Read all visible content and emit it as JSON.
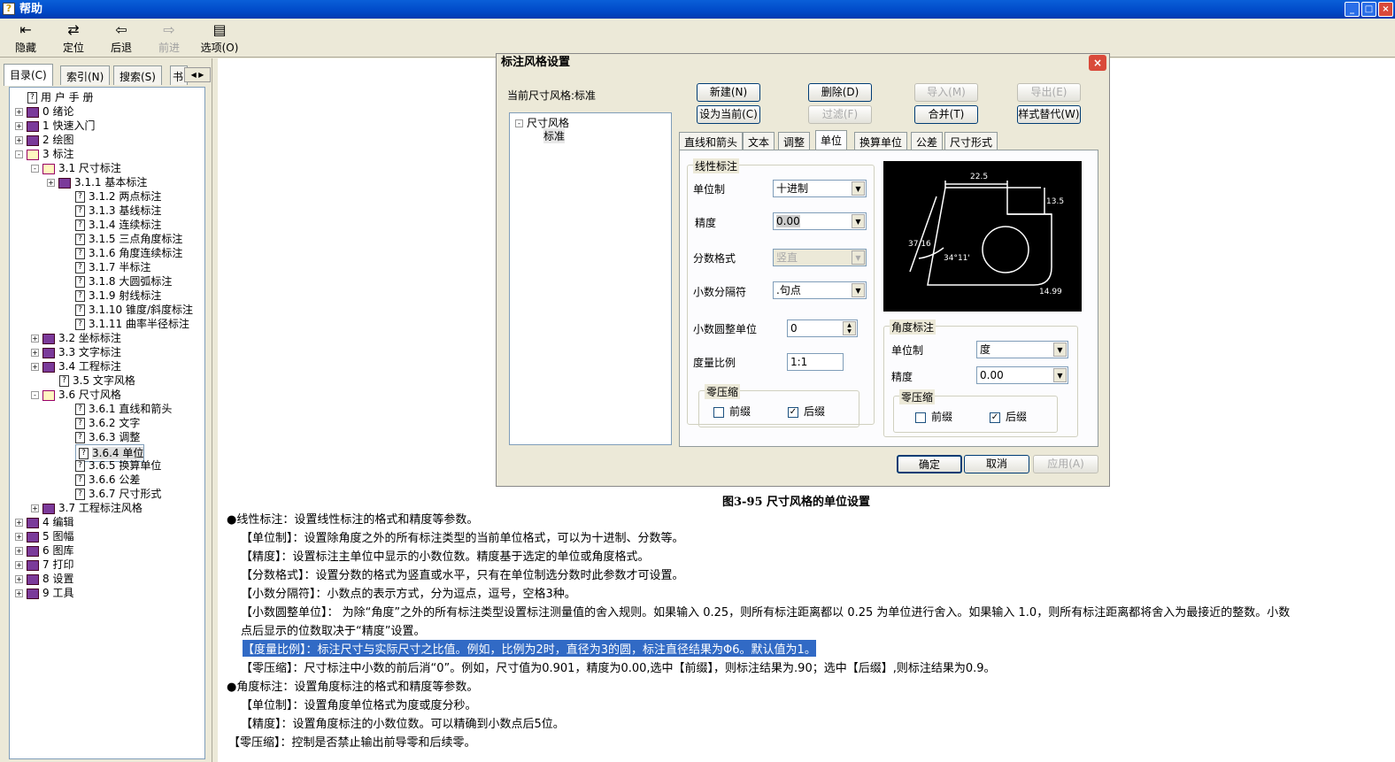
{
  "window": {
    "title": "帮助"
  },
  "toolbar": {
    "hide": "隐藏",
    "locate": "定位",
    "back": "后退",
    "forward": "前进",
    "options": "选项(O)"
  },
  "nav_tabs": [
    "目录(C)",
    "索引(N)",
    "搜索(S)",
    "书"
  ],
  "tree": [
    {
      "label": "用 户 手 册",
      "level": 0,
      "type": "page",
      "exp": ""
    },
    {
      "label": "0 绪论",
      "level": 0,
      "type": "book",
      "exp": "+"
    },
    {
      "label": "1 快速入门",
      "level": 0,
      "type": "book",
      "exp": "+"
    },
    {
      "label": "2 绘图",
      "level": 0,
      "type": "book",
      "exp": "+"
    },
    {
      "label": "3 标注",
      "level": 0,
      "type": "open",
      "exp": "-"
    },
    {
      "label": "3.1 尺寸标注",
      "level": 1,
      "type": "open",
      "exp": "-"
    },
    {
      "label": "3.1.1 基本标注",
      "level": 2,
      "type": "book",
      "exp": "+"
    },
    {
      "label": "3.1.2 两点标注",
      "level": 3,
      "type": "page",
      "exp": ""
    },
    {
      "label": "3.1.3 基线标注",
      "level": 3,
      "type": "page",
      "exp": ""
    },
    {
      "label": "3.1.4 连续标注",
      "level": 3,
      "type": "page",
      "exp": ""
    },
    {
      "label": "3.1.5 三点角度标注",
      "level": 3,
      "type": "page",
      "exp": ""
    },
    {
      "label": "3.1.6 角度连续标注",
      "level": 3,
      "type": "page",
      "exp": ""
    },
    {
      "label": "3.1.7 半标注",
      "level": 3,
      "type": "page",
      "exp": ""
    },
    {
      "label": "3.1.8 大圆弧标注",
      "level": 3,
      "type": "page",
      "exp": ""
    },
    {
      "label": "3.1.9 射线标注",
      "level": 3,
      "type": "page",
      "exp": ""
    },
    {
      "label": "3.1.10 锥度/斜度标注",
      "level": 3,
      "type": "page",
      "exp": ""
    },
    {
      "label": "3.1.11 曲率半径标注",
      "level": 3,
      "type": "page",
      "exp": ""
    },
    {
      "label": "3.2 坐标标注",
      "level": 1,
      "type": "book",
      "exp": "+"
    },
    {
      "label": "3.3 文字标注",
      "level": 1,
      "type": "book",
      "exp": "+"
    },
    {
      "label": "3.4 工程标注",
      "level": 1,
      "type": "book",
      "exp": "+"
    },
    {
      "label": "3.5 文字风格",
      "level": 2,
      "type": "page",
      "exp": ""
    },
    {
      "label": "3.6 尺寸风格",
      "level": 1,
      "type": "open",
      "exp": "-"
    },
    {
      "label": "3.6.1 直线和箭头",
      "level": 3,
      "type": "page",
      "exp": ""
    },
    {
      "label": "3.6.2 文字",
      "level": 3,
      "type": "page",
      "exp": ""
    },
    {
      "label": "3.6.3 调整",
      "level": 3,
      "type": "page",
      "exp": ""
    },
    {
      "label": "3.6.4 单位",
      "level": 3,
      "type": "page",
      "exp": "",
      "selected": true
    },
    {
      "label": "3.6.5 换算单位",
      "level": 3,
      "type": "page",
      "exp": ""
    },
    {
      "label": "3.6.6 公差",
      "level": 3,
      "type": "page",
      "exp": ""
    },
    {
      "label": "3.6.7 尺寸形式",
      "level": 3,
      "type": "page",
      "exp": ""
    },
    {
      "label": "3.7 工程标注风格",
      "level": 1,
      "type": "book",
      "exp": "+"
    },
    {
      "label": "4 编辑",
      "level": 0,
      "type": "book",
      "exp": "+"
    },
    {
      "label": "5 图幅",
      "level": 0,
      "type": "book",
      "exp": "+"
    },
    {
      "label": "6 图库",
      "level": 0,
      "type": "book",
      "exp": "+"
    },
    {
      "label": "7 打印",
      "level": 0,
      "type": "book",
      "exp": "+"
    },
    {
      "label": "8 设置",
      "level": 0,
      "type": "book",
      "exp": "+"
    },
    {
      "label": "9 工具",
      "level": 0,
      "type": "book",
      "exp": "+"
    }
  ],
  "dialog": {
    "title": "标注风格设置",
    "current_style": "当前尺寸风格:标准",
    "style_tree": {
      "root": "尺寸风格",
      "child": "标准"
    },
    "buttons": {
      "new": "新建(N)",
      "delete": "删除(D)",
      "import": "导入(M)",
      "export": "导出(E)",
      "set_current": "设为当前(C)",
      "filter": "过滤(F)",
      "merge": "合并(T)",
      "override": "样式替代(W)"
    },
    "tabs": [
      "直线和箭头",
      "文本",
      "调整",
      "单位",
      "换算单位",
      "公差",
      "尺寸形式"
    ],
    "linear": {
      "group": "线性标注",
      "unit_label": "单位制",
      "unit": "十进制",
      "precision_label": "精度",
      "precision": "0.00",
      "fraction_label": "分数格式",
      "fraction": "竖直",
      "decimal_sep_label": "小数分隔符",
      "decimal_sep": ".句点",
      "round_label": "小数圆整单位",
      "round": "0",
      "scale_label": "度量比例",
      "scale": "1:1",
      "zero_group": "零压缩",
      "leading": "前缀",
      "trailing": "后缀"
    },
    "angular": {
      "group": "角度标注",
      "unit_label": "单位制",
      "unit": "度",
      "precision_label": "精度",
      "precision": "0.00",
      "zero_group": "零压缩",
      "leading": "前缀",
      "trailing": "后缀"
    },
    "preview": {
      "dim1": "22.5",
      "dim2": "13.5",
      "dim3": "37.16",
      "dim4": "34°11'",
      "dim5": "14.99"
    },
    "ok": "确定",
    "cancel": "取消",
    "apply": "应用(A)"
  },
  "caption": "图3-95 尺寸风格的单位设置",
  "body": [
    "●线性标注：设置线性标注的格式和精度等参数。",
    "【单位制】：设置除角度之外的所有标注类型的当前单位格式，可以为十进制、分数等。",
    "【精度】：设置标注主单位中显示的小数位数。精度基于选定的单位或角度格式。",
    "【分数格式】：设置分数的格式为竖直或水平，只有在单位制选分数时此参数才可设置。",
    "【小数分隔符】：小数点的表示方式，分为逗点，逗号，空格3种。",
    "【小数圆整单位】： 为除“角度”之外的所有标注类型设置标注测量值的舍入规则。如果输入 0.25，则所有标注距离都以 0.25 为单位进行舍入。如果输入 1.0，则所有标注距离都将舍入为最接近的整数。小数",
    "点后显示的位数取决于“精度”设置。",
    "【度量比例】：标注尺寸与实际尺寸之比值。例如，比例为2时，直径为3的圆，标注直径结果为Φ6。默认值为1。",
    "【零压缩】：尺寸标注中小数的前后消“0”。例如，尺寸值为0.901，精度为0.00,选中【前缀】，则标注结果为.90；选中【后缀】,则标注结果为0.9。",
    "●角度标注：设置角度标注的格式和精度等参数。",
    "【单位制】：设置角度单位格式为度或度分秒。",
    "【精度】：设置角度标注的小数位数。可以精确到小数点后5位。",
    "【零压缩】：控制是否禁止输出前导零和后续零。"
  ]
}
